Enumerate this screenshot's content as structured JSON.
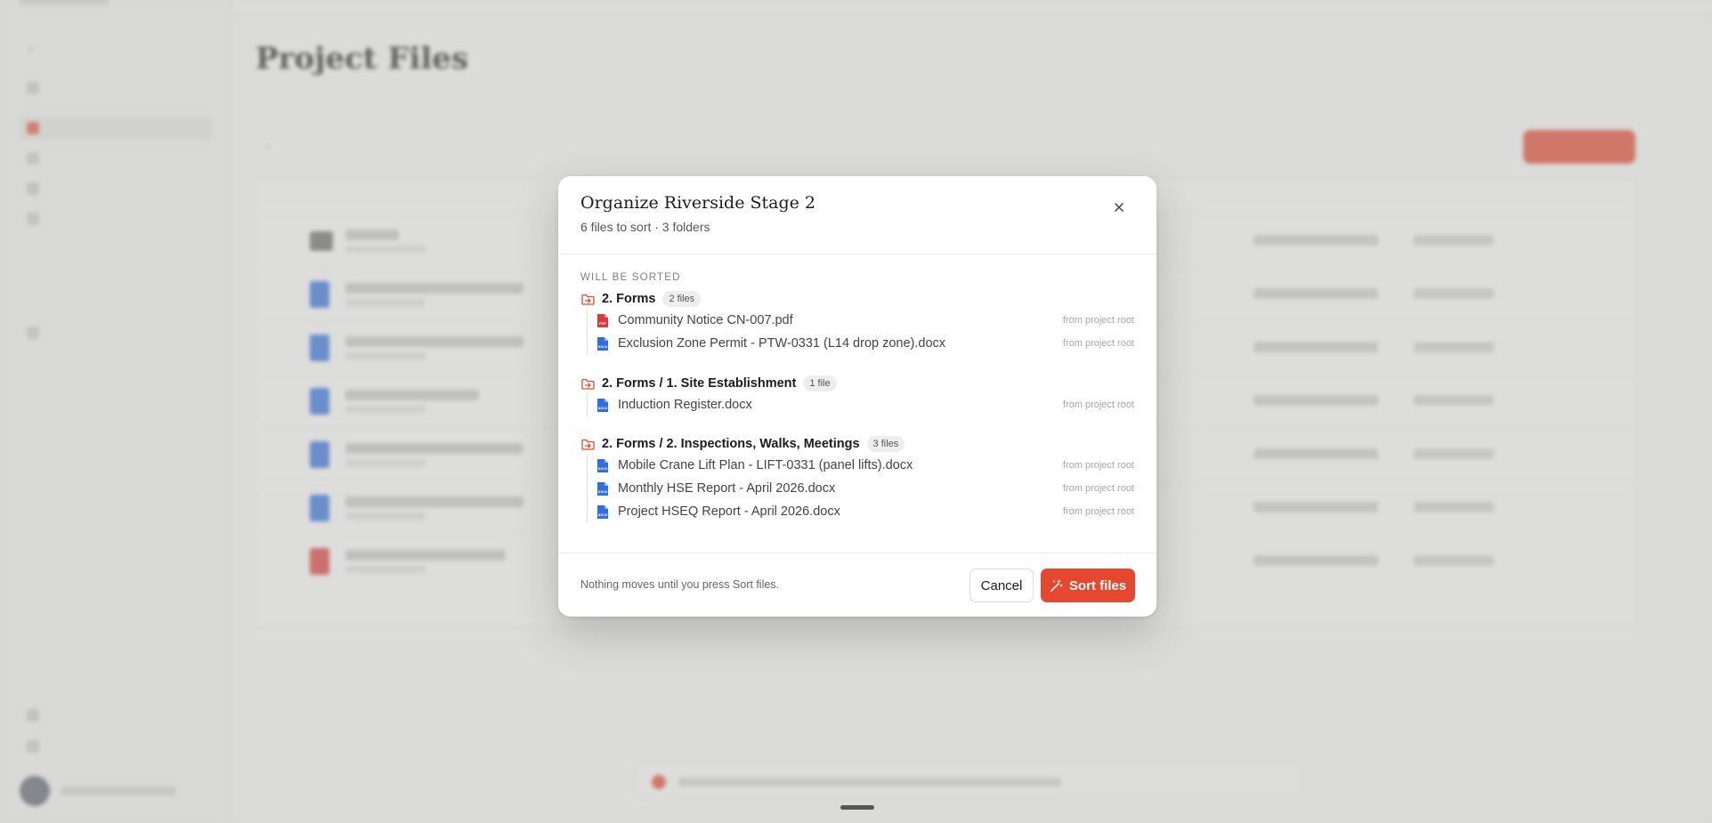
{
  "colors": {
    "accent": "#e5482f",
    "docx": "#2f6de0",
    "pdf": "#e0383a"
  },
  "modal": {
    "title": "Organize Riverside Stage 2",
    "subtitle": "6 files to sort · 3 folders",
    "section_label": "WILL BE SORTED",
    "groups": [
      {
        "name": "2. Forms",
        "badge": "2 files",
        "icon": "folder-move-icon",
        "files": [
          {
            "name": "Community Notice CN-007.pdf",
            "type": "pdf",
            "source": "from project root"
          },
          {
            "name": "Exclusion Zone Permit - PTW-0331 (L14 drop zone).docx",
            "type": "docx",
            "source": "from project root"
          }
        ]
      },
      {
        "name": "2. Forms / 1. Site Establishment",
        "badge": "1 file",
        "icon": "folder-move-icon",
        "files": [
          {
            "name": "Induction Register.docx",
            "type": "docx",
            "source": "from project root"
          }
        ]
      },
      {
        "name": "2. Forms / 2. Inspections, Walks, Meetings",
        "badge": "3 files",
        "icon": "folder-move-icon",
        "files": [
          {
            "name": "Mobile Crane Lift Plan - LIFT-0331 (panel lifts).docx",
            "type": "docx",
            "source": "from project root"
          },
          {
            "name": "Monthly HSE Report - April 2026.docx",
            "type": "docx",
            "source": "from project root"
          },
          {
            "name": "Project HSEQ Report - April 2026.docx",
            "type": "docx",
            "source": "from project root"
          }
        ]
      }
    ],
    "footer_note": "Nothing moves until you press Sort files.",
    "cancel_label": "Cancel",
    "sort_label": "Sort files"
  },
  "background": {
    "page_title": "Project Files"
  }
}
